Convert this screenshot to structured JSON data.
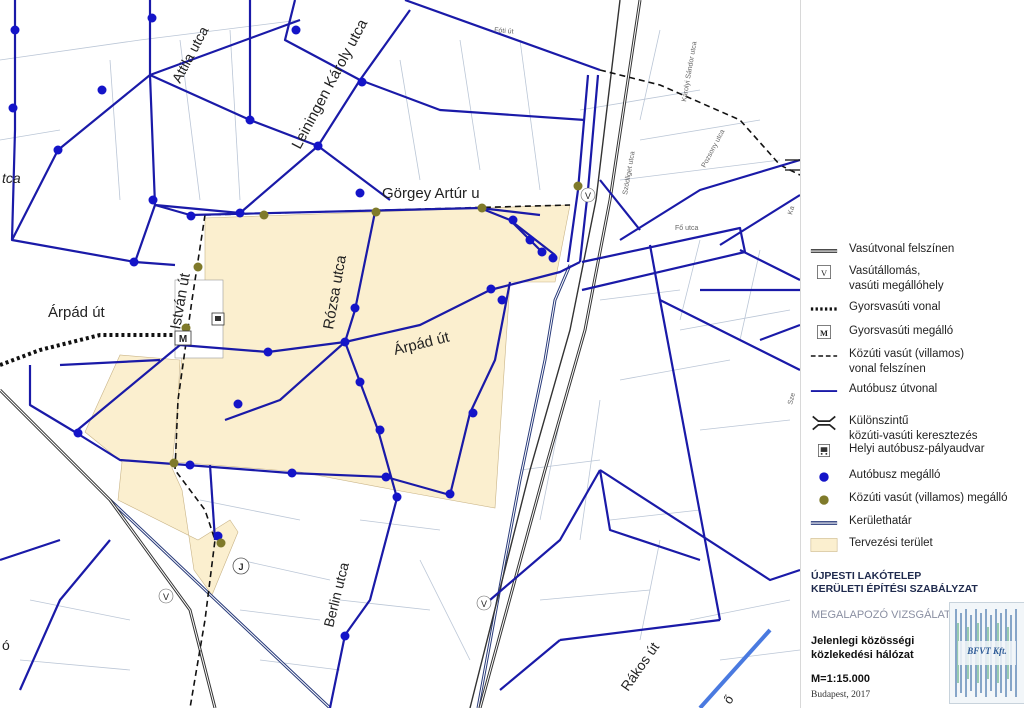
{
  "map": {
    "street_labels": {
      "attila": "Attila utca",
      "leiningen": "Leiningen Károly utca",
      "gorgey": "Görgey Artúr u",
      "istvan": "István út",
      "arpad_west": "Árpád út",
      "rozsa": "Rózsa utca",
      "arpad_center": "Árpád út",
      "berlin": "Berlin utca",
      "rakos": "Rákos út",
      "fragment_utca": "tca",
      "fragment_o": "ó",
      "foti": "Fóti út",
      "karolyi": "Károlyi Sándor utca",
      "szodliget": "Szödliget utca",
      "pozsony": "Pozsony utca",
      "fo": "Fő utca",
      "fragment_ka": "Ka",
      "fragment_sze": "Sze",
      "fragment_o2": "ő"
    },
    "symbols": {
      "m": "M",
      "v1": "V",
      "v2": "V",
      "v3": "V",
      "j": "J"
    }
  },
  "legend": {
    "items": [
      {
        "symbol": "railway-line",
        "label_lines": [
          "Vasútvonal felszínen"
        ]
      },
      {
        "symbol": "railway-station",
        "glyph": "V",
        "label_lines": [
          "Vasútállomás,",
          "vasúti megállóhely"
        ]
      },
      {
        "symbol": "rapid-rail-line",
        "label_lines": [
          "Gyorsvasúti vonal"
        ]
      },
      {
        "symbol": "rapid-rail-stop",
        "glyph": "M",
        "label_lines": [
          "Gyorsvasúti megálló"
        ]
      },
      {
        "symbol": "tram-line",
        "label_lines": [
          "Közúti vasút (villamos)",
          "vonal felszínen"
        ]
      },
      {
        "symbol": "bus-route",
        "label_lines": [
          "Autóbusz útvonal"
        ]
      },
      {
        "symbol": "grade-separated-crossing",
        "label_lines": [
          "Különszintű",
          "közúti-vasúti keresztezés"
        ]
      },
      {
        "symbol": "bus-terminal",
        "label_lines": [
          "Helyi autóbusz-pályaudvar"
        ]
      },
      {
        "symbol": "bus-stop",
        "label_lines": [
          "Autóbusz megálló"
        ]
      },
      {
        "symbol": "tram-stop",
        "label_lines": [
          "Közúti vasút (villamos) megálló"
        ]
      },
      {
        "symbol": "district-boundary",
        "label_lines": [
          "Kerülethatár"
        ]
      },
      {
        "symbol": "planning-area",
        "label_lines": [
          "Tervezési terület"
        ]
      }
    ]
  },
  "title_block": {
    "project_line1": "ÚJPESTI LAKÓTELEP",
    "project_line2": "KERÜLETI ÉPÍTÉSI SZABÁLYZAT",
    "subtitle": "MEGALAPOZÓ VIZSGÁLAT",
    "map_title_line1": "Jelenlegi közösségi",
    "map_title_line2": "közlekedési hálózat",
    "scale": "M=1:15.000",
    "place_date": "Budapest, 2017",
    "logo_text": "BFVT Kft."
  },
  "colors": {
    "bus_route": "#1a1aa8",
    "bus_stop": "#1414c8",
    "tram_stop": "#7f7a2a",
    "planning_area": "#fbefcf",
    "district_boundary": "#283a7a",
    "rail": "#333333",
    "thin_street": "#9fb0c8",
    "title_text": "#1f2a4d"
  }
}
